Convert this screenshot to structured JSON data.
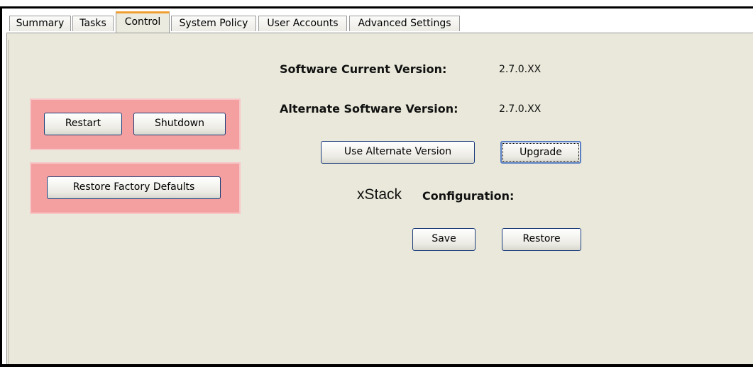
{
  "tabs": [
    {
      "label": "Summary"
    },
    {
      "label": "Tasks"
    },
    {
      "label": "Control"
    },
    {
      "label": "System Policy"
    },
    {
      "label": "User Accounts"
    },
    {
      "label": "Advanced Settings"
    }
  ],
  "active_tab": "Control",
  "power": {
    "restart_label": "Restart",
    "shutdown_label": "Shutdown"
  },
  "factory": {
    "restore_defaults_label": "Restore Factory Defaults"
  },
  "software": {
    "current_label": "Software Current Version:",
    "current_value": "2.7.0.XX",
    "alternate_label": "Alternate Software Version:",
    "alternate_value": "2.7.0.XX",
    "use_alternate_label": "Use Alternate Version",
    "upgrade_label": "Upgrade"
  },
  "configuration": {
    "brand": "xStack",
    "label": "Configuration:",
    "save_label": "Save",
    "restore_label": "Restore"
  },
  "colors": {
    "panel_bg": "#e9e8da",
    "highlight_box": "#f4a0a0",
    "active_tab_accent": "#f0a030",
    "button_border": "#1b3c7a"
  }
}
